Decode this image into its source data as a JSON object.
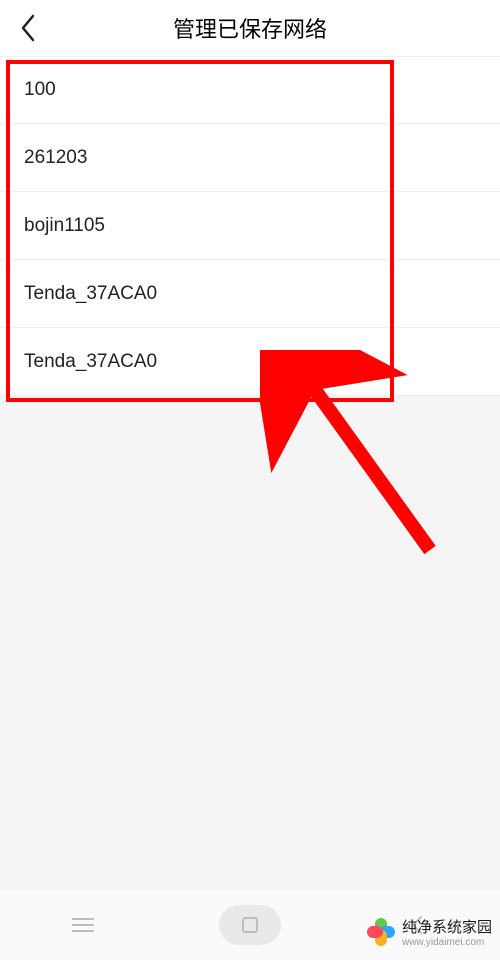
{
  "header": {
    "title": "管理已保存网络"
  },
  "networks": [
    {
      "name": "100"
    },
    {
      "name": "261203"
    },
    {
      "name": "bojin1105"
    },
    {
      "name": "Tenda_37ACA0"
    },
    {
      "name": "Tenda_37ACA0"
    }
  ],
  "watermark": {
    "brand": "纯净系统家园",
    "url": "www.yidaimei.com"
  },
  "annotation": {
    "arrow_color": "#ff0000",
    "box_color": "#ff0000"
  }
}
